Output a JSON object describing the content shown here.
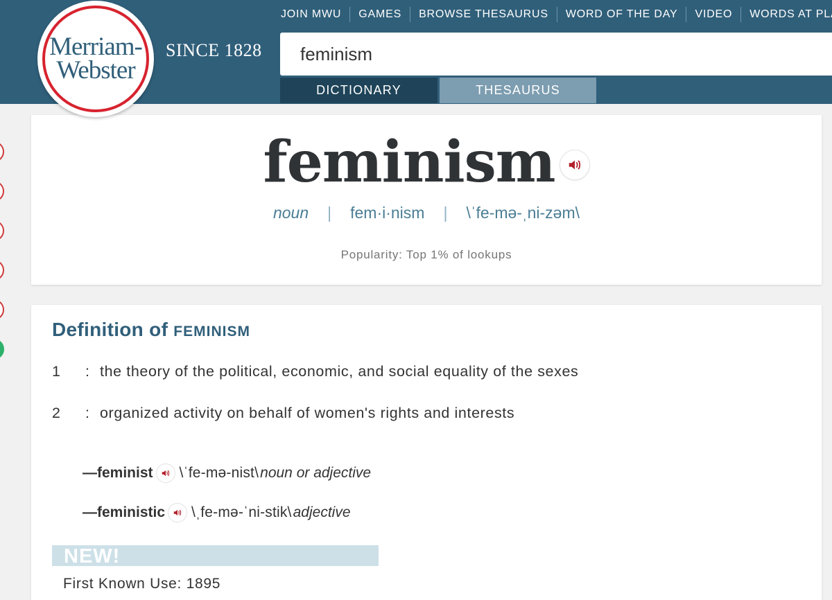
{
  "brand": {
    "logo_line1": "Merriam-",
    "logo_line2": "Webster",
    "since": "SINCE 1828"
  },
  "top_nav": [
    "JOIN MWU",
    "GAMES",
    "BROWSE THESAURUS",
    "WORD OF THE DAY",
    "VIDEO",
    "WORDS AT PLAY"
  ],
  "search": {
    "value": "feminism"
  },
  "tabs": {
    "dictionary": "DICTIONARY",
    "thesaurus": "THESAURUS",
    "active": "dictionary"
  },
  "entry": {
    "headword": "feminism",
    "part_of_speech": "noun",
    "syllables": "fem·i·nism",
    "pronunciation": "\\ˈfe-mə-ˌni-zəm\\",
    "popularity": "Popularity: Top 1% of lookups"
  },
  "definition": {
    "heading_prefix": "Definition of",
    "heading_word": "FEMINISM",
    "senses": [
      {
        "num": "1",
        "colon": ":",
        "text": "the theory of the political, economic, and social equality of the sexes"
      },
      {
        "num": "2",
        "colon": ":",
        "text": "organized activity on behalf of women's rights and interests"
      }
    ],
    "run_ons": [
      {
        "word": "—feminist",
        "pron": "\\ˈfe-mə-nist\\",
        "pos": "noun or adjective"
      },
      {
        "word": "—feministic",
        "pron": "\\ˌfe-mə-ˈni-stik\\",
        "pos": "adjective"
      }
    ],
    "new_label": "NEW!",
    "first_known_use": "First Known Use: 1895"
  },
  "colors": {
    "header": "#305f7a",
    "tab_active": "#1f4459",
    "tab_inactive": "#7d9db0",
    "accent_red": "#d7232f",
    "link_blue": "#4a7d95"
  },
  "icons": {
    "audio": "speaker-icon"
  }
}
